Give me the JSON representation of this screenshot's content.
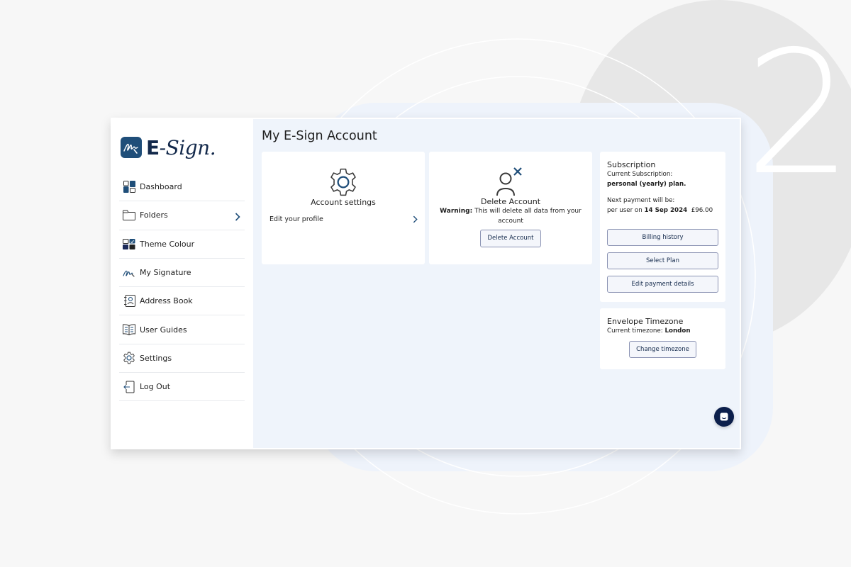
{
  "background": {
    "step_number": "2",
    "colors": {
      "page": "#f7f7f7",
      "blob": "#e7e7e7",
      "panel": "#eef3fb",
      "rings": "#ffffff"
    }
  },
  "brand": {
    "logo_prefix": "E",
    "logo_suffix": "-Sign.",
    "primary_color": "#1f4e79",
    "dark_color": "#13294b"
  },
  "sidebar": {
    "items": [
      {
        "label": "Dashboard",
        "icon": "dashboard-icon",
        "has_chevron": false
      },
      {
        "label": "Folders",
        "icon": "folder-icon",
        "has_chevron": true
      },
      {
        "label": "Theme Colour",
        "icon": "theme-colour-icon",
        "has_chevron": false
      },
      {
        "label": "My Signature",
        "icon": "signature-icon",
        "has_chevron": false
      },
      {
        "label": "Address Book",
        "icon": "address-book-icon",
        "has_chevron": false
      },
      {
        "label": "User Guides",
        "icon": "book-icon",
        "has_chevron": false
      },
      {
        "label": "Settings",
        "icon": "gear-icon",
        "has_chevron": false
      },
      {
        "label": "Log Out",
        "icon": "logout-icon",
        "has_chevron": false
      }
    ]
  },
  "main": {
    "title": "My E-Sign Account",
    "account_settings": {
      "heading": "Account settings",
      "icon": "gear-icon",
      "link_label": "Edit your profile"
    },
    "delete_account": {
      "heading": "Delete Account",
      "icon": "user-remove-icon",
      "warning_label": "Warning:",
      "warning_text": "This will delete all data from your account",
      "button_label": "Delete Account"
    },
    "subscription": {
      "heading": "Subscription",
      "current_label": "Current Subscription:",
      "plan": "personal (yearly) plan.",
      "next_payment_label": "Next payment will be:",
      "per_user_prefix": "per user on",
      "next_payment_date": "14 Sep 2024",
      "next_payment_amount": "£96.00",
      "buttons": [
        "Billing history",
        "Select Plan",
        "Edit payment details"
      ]
    },
    "timezone": {
      "heading": "Envelope Timezone",
      "current_label": "Current timezone:",
      "current_value": "London",
      "button_label": "Change timezone"
    },
    "chat_button": {
      "icon": "chat-icon"
    }
  }
}
